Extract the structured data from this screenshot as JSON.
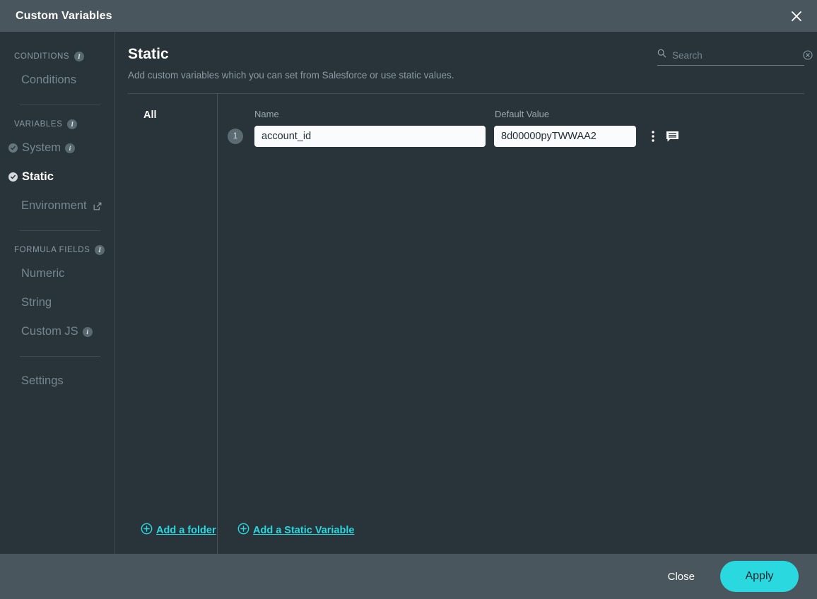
{
  "titlebar": {
    "title": "Custom Variables",
    "close_icon": "close-icon"
  },
  "sidebar": {
    "groups": [
      {
        "label": "CONDITIONS",
        "has_info": true,
        "items": [
          {
            "label": "Conditions",
            "state": "muted",
            "check": false,
            "info": false,
            "external": false
          }
        ]
      },
      {
        "label": "VARIABLES",
        "has_info": true,
        "items": [
          {
            "label": "System",
            "state": "muted",
            "check": true,
            "info": true,
            "external": false
          },
          {
            "label": "Static",
            "state": "active",
            "check": true,
            "info": false,
            "external": false
          },
          {
            "label": "Environment",
            "state": "muted",
            "check": false,
            "info": false,
            "external": true
          }
        ]
      },
      {
        "label": "FORMULA FIELDS",
        "has_info": true,
        "items": [
          {
            "label": "Numeric",
            "state": "muted",
            "check": false,
            "info": false,
            "external": false
          },
          {
            "label": "String",
            "state": "muted",
            "check": false,
            "info": false,
            "external": false
          },
          {
            "label": "Custom JS",
            "state": "muted",
            "check": false,
            "info": true,
            "external": false
          }
        ]
      },
      {
        "label": "",
        "has_info": false,
        "items": [
          {
            "label": "Settings",
            "state": "muted",
            "check": false,
            "info": false,
            "external": false
          }
        ]
      }
    ]
  },
  "main": {
    "title": "Static",
    "subtitle": "Add custom variables which you can set from Salesforce or use static values."
  },
  "search": {
    "placeholder": "Search",
    "value": "",
    "icon": "search-icon",
    "clear_icon": "clear-circle-icon"
  },
  "folders": {
    "items": [
      {
        "label": "All"
      }
    ],
    "add_label": "Add a folder"
  },
  "table": {
    "columns": {
      "name": "Name",
      "default_value": "Default Value"
    },
    "rows": [
      {
        "index": "1",
        "name": "account_id",
        "default_value": "8d00000pyTWWAA2",
        "menu_icon": "kebab-menu-icon",
        "note_icon": "comment-icon"
      }
    ],
    "add_label": "Add a Static Variable"
  },
  "footer": {
    "close_label": "Close",
    "apply_label": "Apply"
  },
  "colors": {
    "accent": "#2ad8e0",
    "titlebar": "#4a565e",
    "background": "#28333a",
    "field": "#fafbfc"
  }
}
